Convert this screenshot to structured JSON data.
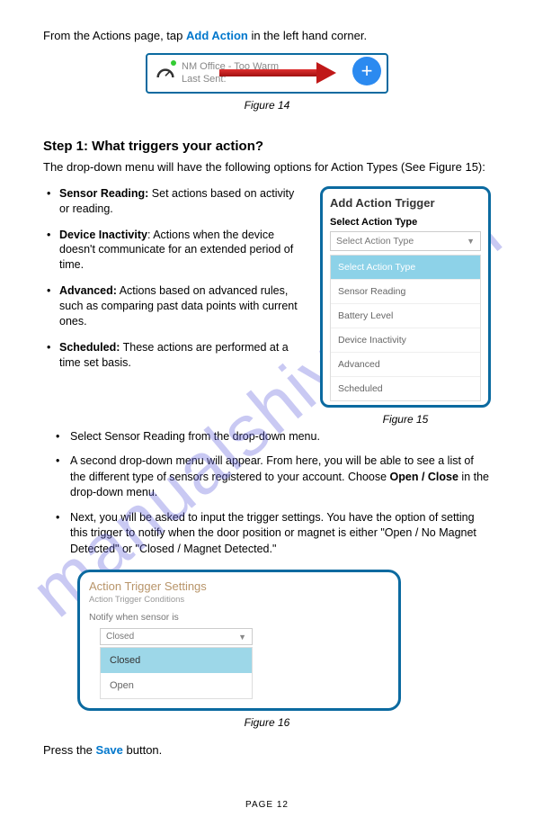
{
  "watermark": "manualshive.com",
  "intro": {
    "pre": "From the Actions page, tap ",
    "bold": "Add Action",
    "post": " in the left hand corner."
  },
  "fig14": {
    "line1": "NM Office - Too Warm",
    "line2": "Last Sent:",
    "plus_label": "+",
    "caption": "Figure 14"
  },
  "step1": {
    "heading": "Step 1: What triggers your action?",
    "desc": "The drop-down menu will have the following options for Action Types (See Figure 15):",
    "items": [
      {
        "bold": "Sensor Reading:",
        "text": " Set actions based on activity or reading."
      },
      {
        "bold": "Device Inactivity",
        "text": ": Actions when the device doesn't communicate for an extended period of time."
      },
      {
        "bold": "Advanced:",
        "text": " Actions based on advanced rules, such as comparing past data points with current ones."
      },
      {
        "bold": "Scheduled:",
        "text": " These actions are performed at a time set basis."
      }
    ]
  },
  "fig15": {
    "title": "Add Action Trigger",
    "label": "Select Action Type",
    "placeholder": "Select Action Type",
    "options": [
      "Select Action Type",
      "Sensor Reading",
      "Battery Level",
      "Device Inactivity",
      "Advanced",
      "Scheduled"
    ],
    "caption": "Figure 15"
  },
  "bullets2": [
    {
      "text": "Select Sensor Reading from the drop-down menu."
    },
    {
      "pre": "A second drop-down menu will appear. From here, you will be able to see a list of the different type of sensors registered to your account. Choose ",
      "bold": "Open / Close",
      "post": " in the drop-down menu."
    },
    {
      "text": "Next, you will be asked to input the trigger settings. You have the option of setting this trigger to notify when the door position or magnet is either \"Open / No Magnet Detected\" or \"Closed / Magnet Detected.\""
    }
  ],
  "fig16": {
    "title": "Action Trigger Settings",
    "sub": "Action Trigger Conditions",
    "notify": "Notify when sensor is",
    "selected": "Closed",
    "options": [
      "Closed",
      "Open"
    ],
    "caption": "Figure 16"
  },
  "save": {
    "pre": "Press the ",
    "bold": "Save",
    "post": " button."
  },
  "page": "PAGE  12"
}
